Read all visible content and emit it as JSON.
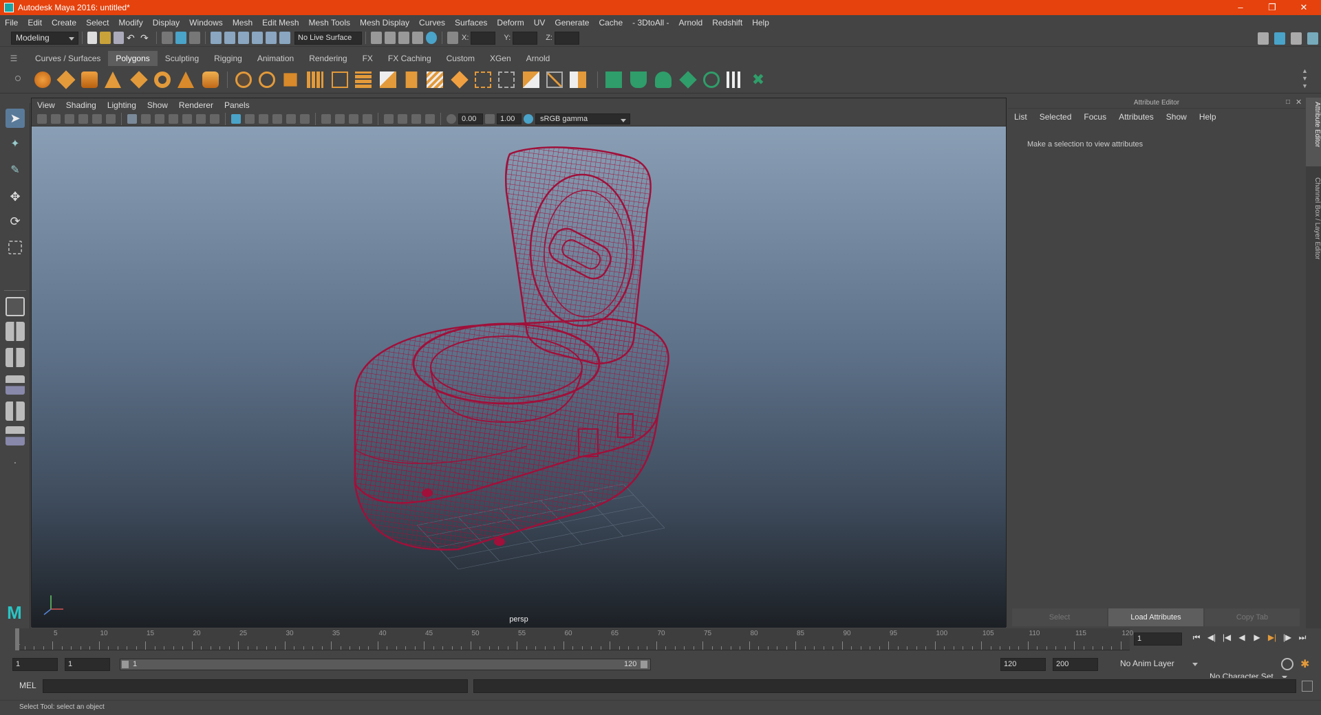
{
  "window": {
    "title": "Autodesk Maya 2016: untitled*"
  },
  "menu": [
    "File",
    "Edit",
    "Create",
    "Select",
    "Modify",
    "Display",
    "Windows",
    "Mesh",
    "Edit Mesh",
    "Mesh Tools",
    "Mesh Display",
    "Curves",
    "Surfaces",
    "Deform",
    "UV",
    "Generate",
    "Cache",
    "- 3DtoAll -",
    "Arnold",
    "Redshift",
    "Help"
  ],
  "status": {
    "mode": "Modeling",
    "live_surface": "No Live Surface",
    "x_label": "X:",
    "y_label": "Y:",
    "z_label": "Z:"
  },
  "shelf_tabs": [
    "Curves / Surfaces",
    "Polygons",
    "Sculpting",
    "Rigging",
    "Animation",
    "Rendering",
    "FX",
    "FX Caching",
    "Custom",
    "XGen",
    "Arnold"
  ],
  "shelf_active": "Polygons",
  "viewport": {
    "menu": [
      "View",
      "Shading",
      "Lighting",
      "Show",
      "Renderer",
      "Panels"
    ],
    "exposure": "0.00",
    "gamma": "1.00",
    "color_space": "sRGB gamma",
    "camera": "persp"
  },
  "attribute_editor": {
    "title": "Attribute Editor",
    "menu": [
      "List",
      "Selected",
      "Focus",
      "Attributes",
      "Show",
      "Help"
    ],
    "message": "Make a selection to view attributes",
    "buttons": [
      "Select",
      "Load Attributes",
      "Copy Tab"
    ]
  },
  "side_tabs": [
    "Attribute Editor",
    "Channel Box / Layer Editor"
  ],
  "timeline": {
    "ticks": [
      1,
      5,
      10,
      15,
      20,
      25,
      30,
      35,
      40,
      45,
      50,
      55,
      60,
      65,
      70,
      75,
      80,
      85,
      90,
      95,
      100,
      105,
      110,
      115,
      120
    ],
    "current_frame": "1"
  },
  "range": {
    "start": "1",
    "playback_start": "1",
    "slider_start": "1",
    "slider_end": "120",
    "playback_end": "120",
    "end": "200",
    "anim_layer": "No Anim Layer",
    "character_set": "No Character Set"
  },
  "command": {
    "lang": "MEL"
  },
  "help": {
    "text": "Select Tool: select an object"
  },
  "colors": {
    "title_bar": "#e5420d",
    "wireframe": "#a0103a",
    "accent": "#4aa3c9"
  }
}
